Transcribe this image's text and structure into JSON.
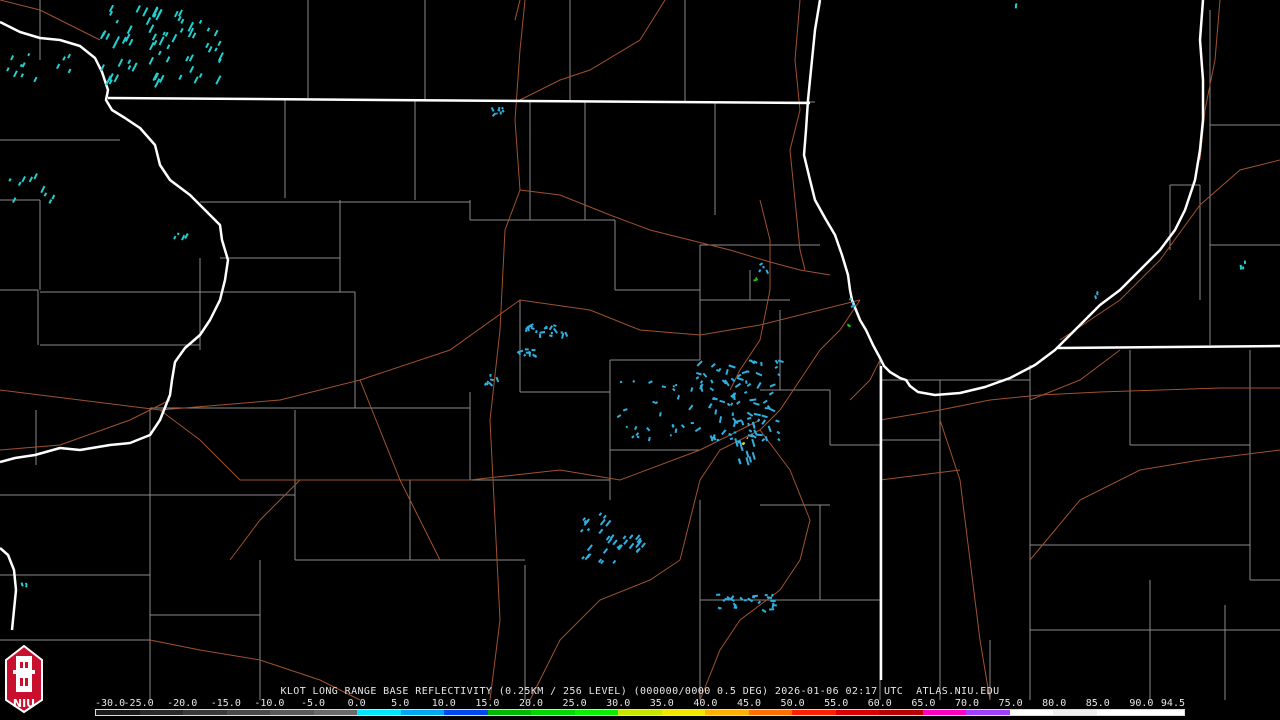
{
  "radar": {
    "caption": "KLOT LONG RANGE BASE REFLECTIVITY (0.25KM / 256 LEVEL) (000000/0000 0.5 DEG) 2026-01-06 02:17 UTC  ATLAS.NIU.EDU"
  },
  "logo": {
    "text": "NIU",
    "icon": "university-tower-icon"
  },
  "scale": {
    "labels": [
      "-30.0",
      "-25.0",
      "-20.0",
      "-15.0",
      "-10.0",
      "-5.0",
      "0.0",
      "5.0",
      "10.0",
      "15.0",
      "20.0",
      "25.0",
      "30.0",
      "35.0",
      "40.0",
      "45.0",
      "50.0",
      "55.0",
      "60.0",
      "65.0",
      "70.0",
      "75.0",
      "80.0",
      "85.0",
      "90.0",
      "94.5"
    ],
    "colors": [
      "#1a1a1a",
      "#2a2a2a",
      "#3a3a3a",
      "#4a4a4a",
      "#5a5a5a",
      "#6a6a6a",
      "#00e4ff",
      "#00a8f0",
      "#0048f0",
      "#00b800",
      "#00d800",
      "#08f000",
      "#c8e600",
      "#f0e600",
      "#ffb000",
      "#ff7000",
      "#ff2000",
      "#d80000",
      "#b80000",
      "#ff00c0",
      "#a040ff",
      "#ffffff",
      "#f0f0f0",
      "#ffffff",
      "#ffffff"
    ]
  },
  "colors": {
    "state_border": "#ffffff",
    "county_border": "#8a8a8a",
    "highway": "#a0522d",
    "echo_light": "#2fb0e0",
    "echo_cyan": "#20d0d0",
    "echo_green": "#20c020",
    "echo_yellow": "#e0e020"
  }
}
